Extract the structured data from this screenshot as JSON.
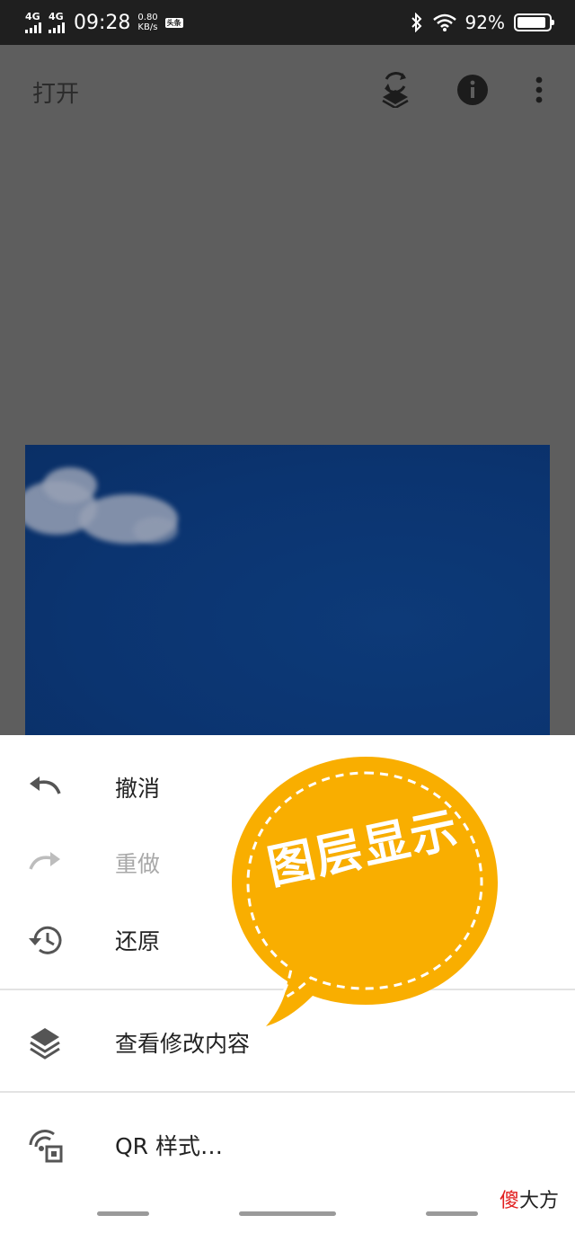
{
  "status_bar": {
    "signal_1": "4G",
    "signal_2": "4G",
    "time": "09:28",
    "speed_value": "0.80",
    "speed_unit": "KB/s",
    "app_badge": "头条",
    "battery_percent": "92%",
    "battery_level": 0.92
  },
  "app_bar": {
    "title": "打开",
    "icons": [
      "layers-refresh-icon",
      "info-icon",
      "more-vert-icon"
    ]
  },
  "menu": {
    "items": [
      {
        "label": "撤消",
        "icon": "undo-icon",
        "enabled": true
      },
      {
        "label": "重做",
        "icon": "redo-icon",
        "enabled": false
      },
      {
        "label": "还原",
        "icon": "history-icon",
        "enabled": true
      },
      {
        "label": "查看修改内容",
        "icon": "layers-icon",
        "enabled": true
      },
      {
        "label": "QR 样式…",
        "icon": "qr-style-icon",
        "enabled": true
      }
    ]
  },
  "sticker": {
    "text": "图层显示",
    "color": "#F9AE00"
  },
  "watermark": {
    "red_char": "傻",
    "rest": "大方"
  },
  "colors": {
    "status_bar": "#1f1f1f",
    "scrim": "#5e5e5e",
    "sheet": "#ffffff",
    "sky": "#0b3470"
  }
}
